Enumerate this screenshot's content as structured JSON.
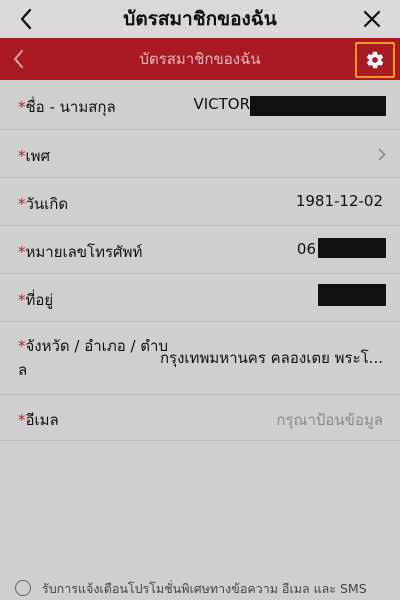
{
  "window": {
    "title": "บัตรสมาชิกของฉัน"
  },
  "header": {
    "title": "บัตรสมาชิกของฉัน"
  },
  "form": {
    "required_marker": "*",
    "name": {
      "label": "ชื่อ - นามสกุล",
      "value": "VICTOR"
    },
    "gender": {
      "label": "เพศ"
    },
    "birthday": {
      "label": "วันเกิด",
      "value": "1981-12-02"
    },
    "phone": {
      "label": "หมายเลขโทรศัพท์",
      "value": "06"
    },
    "address": {
      "label": "ที่อยู่"
    },
    "province": {
      "label_line1": "จังหวัด / อำเภอ / ตำบ",
      "label_line2": "ล",
      "value": "กรุงเทพมหานคร คลองเตย พระโ..."
    },
    "email": {
      "label": "อีเมล",
      "placeholder": "กรุณาป้อนข้อมูล"
    }
  },
  "footer": {
    "consent_text": "รับการแจ้งเตือนโปรโมชั่นพิเศษทางข้อความ อีเมล และ SMS"
  },
  "colors": {
    "brand_red": "#a91a22",
    "highlight_orange": "#f39a1f"
  }
}
